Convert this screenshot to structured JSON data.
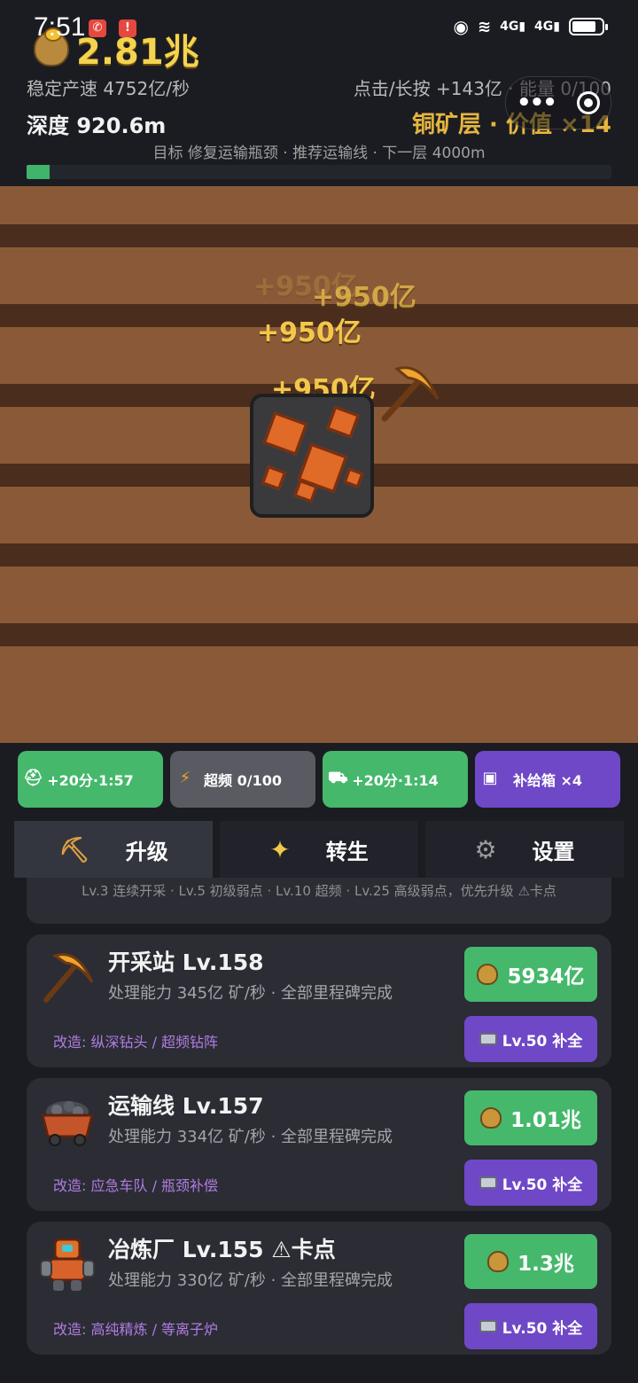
{
  "status_bar": {
    "time": "7:51",
    "network": "4G",
    "network2": "4G"
  },
  "header": {
    "gold": "2.81兆",
    "rate": "稳定产速 4752亿/秒",
    "tap": "点击/长按 +143亿 · 能量 0/100",
    "depth": "深度 920.6m",
    "layer": "铜矿层 · 价值 ×14",
    "goal": "目标 修复运输瓶颈 · 推荐运输线 · 下一层 4000m",
    "progress_fraction": 0.04
  },
  "scene": {
    "float_texts": [
      "+950亿",
      "+950亿",
      "+950亿",
      "+950亿"
    ]
  },
  "boosts": [
    {
      "label": "+20分·1:57",
      "icon": "drill-robot-icon",
      "color": "#45b86b"
    },
    {
      "label": "超频 0/100",
      "icon": "lightning-icon",
      "color": "#5a5b62"
    },
    {
      "label": "+20分·1:14",
      "icon": "minecart-icon",
      "color": "#45b86b"
    },
    {
      "label": "补给箱 ×4",
      "icon": "video-icon",
      "color": "#6f48c7"
    }
  ],
  "tabs": [
    {
      "label": "升级",
      "icon": "pickaxe-icon"
    },
    {
      "label": "转生",
      "icon": "sparkle-icon"
    },
    {
      "label": "设置",
      "icon": "gear-icon"
    }
  ],
  "partial_card_text": "Lv.3 连续开采 · Lv.5 初级弱点 · Lv.10 超频 · Lv.25 高级弱点，优先升级 ⚠卡点",
  "cards": [
    {
      "title": "开采站 Lv.158",
      "desc": "处理能力 345亿 矿/秒 · 全部里程碑完成",
      "mod": "改造: 纵深钻头 / 超频钻阵",
      "price": "5934亿",
      "fill": "Lv.50 补全"
    },
    {
      "title": "运输线 Lv.157",
      "desc": "处理能力 334亿 矿/秒 · 全部里程碑完成",
      "mod": "改造: 应急车队 / 瓶颈补偿",
      "price": "1.01兆",
      "fill": "Lv.50 补全"
    },
    {
      "title": "冶炼厂 Lv.155 ⚠卡点",
      "desc": "处理能力 330亿 矿/秒 · 全部里程碑完成",
      "mod": "改造: 高纯精炼 / 等离子炉",
      "price": "1.3兆",
      "fill": "Lv.50 补全"
    }
  ]
}
